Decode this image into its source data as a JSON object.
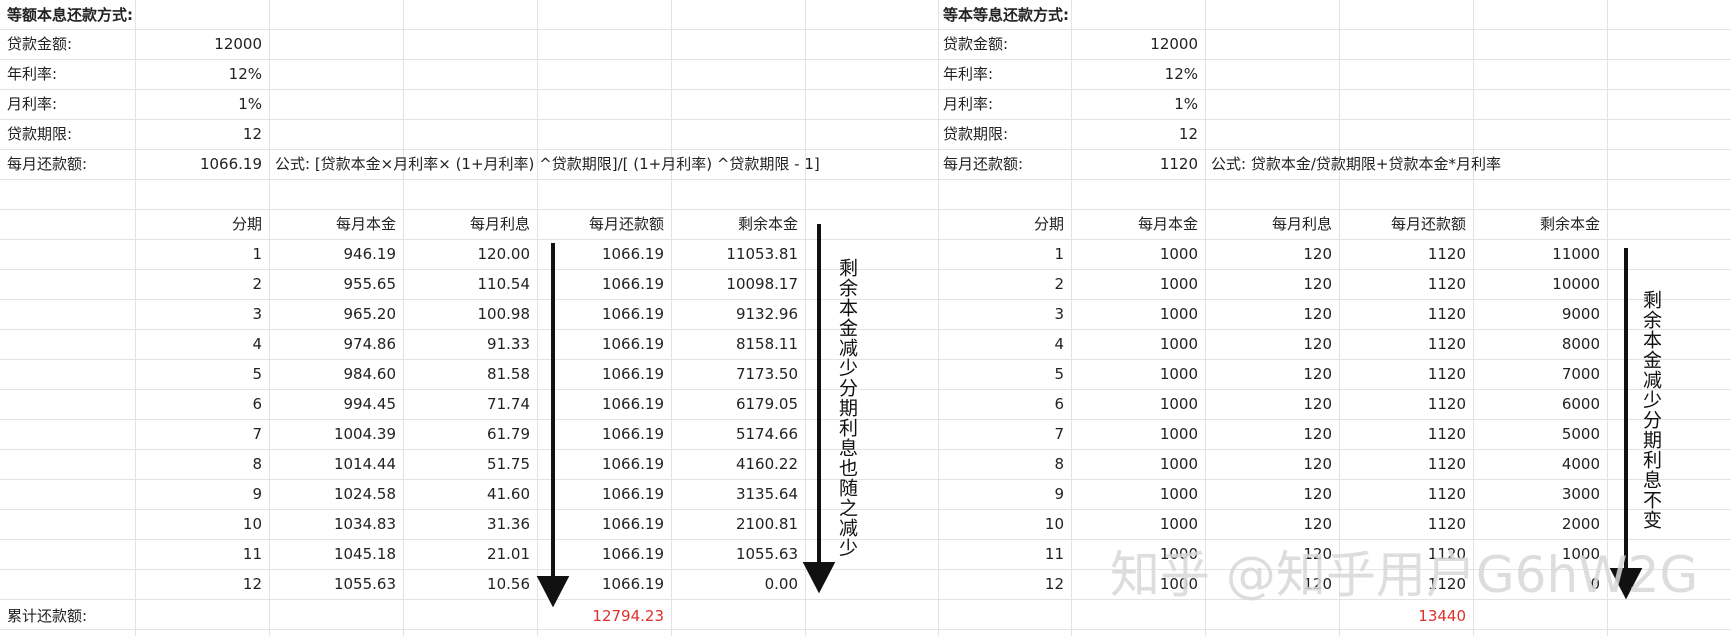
{
  "left": {
    "title": "等额本息还款方式:",
    "params": [
      {
        "label": "贷款金额:",
        "value": "12000"
      },
      {
        "label": "年利率:",
        "value": "12%"
      },
      {
        "label": "月利率:",
        "value": "1%"
      },
      {
        "label": "贷款期限:",
        "value": "12"
      },
      {
        "label": "每月还款额:",
        "value": "1066.19"
      }
    ],
    "formula": "公式: [贷款本金×月利率× (1+月利率) ^贷款期限]/[ (1+月利率) ^贷款期限 - 1]",
    "headers": [
      "分期",
      "每月本金",
      "每月利息",
      "每月还款额",
      "剩余本金"
    ],
    "rows": [
      [
        "1",
        "946.19",
        "120.00",
        "1066.19",
        "11053.81"
      ],
      [
        "2",
        "955.65",
        "110.54",
        "1066.19",
        "10098.17"
      ],
      [
        "3",
        "965.20",
        "100.98",
        "1066.19",
        "9132.96"
      ],
      [
        "4",
        "974.86",
        "91.33",
        "1066.19",
        "8158.11"
      ],
      [
        "5",
        "984.60",
        "81.58",
        "1066.19",
        "7173.50"
      ],
      [
        "6",
        "994.45",
        "71.74",
        "1066.19",
        "6179.05"
      ],
      [
        "7",
        "1004.39",
        "61.79",
        "1066.19",
        "5174.66"
      ],
      [
        "8",
        "1014.44",
        "51.75",
        "1066.19",
        "4160.22"
      ],
      [
        "9",
        "1024.58",
        "41.60",
        "1066.19",
        "3135.64"
      ],
      [
        "10",
        "1034.83",
        "31.36",
        "1066.19",
        "2100.81"
      ],
      [
        "11",
        "1045.18",
        "21.01",
        "1066.19",
        "1055.63"
      ],
      [
        "12",
        "1055.63",
        "10.56",
        "1066.19",
        "0.00"
      ]
    ],
    "total_label": "累计还款额:",
    "total_value": "12794.23",
    "annotation": "剩余本金减少分期利息也随之减少"
  },
  "right": {
    "title": "等本等息还款方式:",
    "params": [
      {
        "label": "贷款金额:",
        "value": "12000"
      },
      {
        "label": "年利率:",
        "value": "12%"
      },
      {
        "label": "月利率:",
        "value": "1%"
      },
      {
        "label": "贷款期限:",
        "value": "12"
      },
      {
        "label": "每月还款额:",
        "value": "1120"
      }
    ],
    "formula": "公式: 贷款本金/贷款期限+贷款本金*月利率",
    "headers": [
      "分期",
      "每月本金",
      "每月利息",
      "每月还款额",
      "剩余本金"
    ],
    "rows": [
      [
        "1",
        "1000",
        "120",
        "1120",
        "11000"
      ],
      [
        "2",
        "1000",
        "120",
        "1120",
        "10000"
      ],
      [
        "3",
        "1000",
        "120",
        "1120",
        "9000"
      ],
      [
        "4",
        "1000",
        "120",
        "1120",
        "8000"
      ],
      [
        "5",
        "1000",
        "120",
        "1120",
        "7000"
      ],
      [
        "6",
        "1000",
        "120",
        "1120",
        "6000"
      ],
      [
        "7",
        "1000",
        "120",
        "1120",
        "5000"
      ],
      [
        "8",
        "1000",
        "120",
        "1120",
        "4000"
      ],
      [
        "9",
        "1000",
        "120",
        "1120",
        "3000"
      ],
      [
        "10",
        "1000",
        "120",
        "1120",
        "2000"
      ],
      [
        "11",
        "1000",
        "120",
        "1120",
        "1000"
      ],
      [
        "12",
        "1000",
        "120",
        "1120",
        "0"
      ]
    ],
    "total_value": "13440",
    "annotation": "剩余本金减少分期利息不变"
  },
  "watermark": "知乎 @知乎用户G6hW2G",
  "colors": {
    "total": "#e0302a",
    "grid": "#e3e3e3"
  }
}
